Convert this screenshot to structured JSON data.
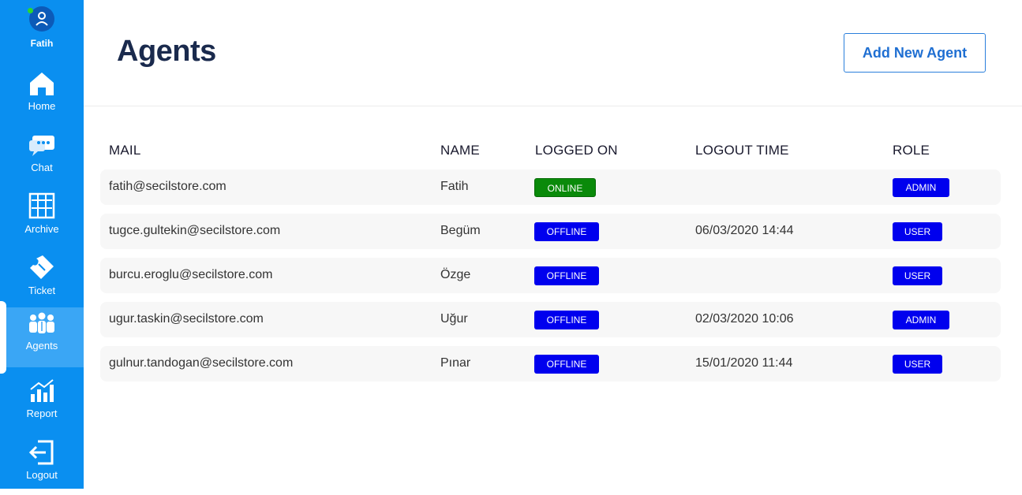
{
  "sidebar": {
    "user": {
      "name": "Fatih"
    },
    "items": [
      {
        "label": "Home",
        "icon": "home-icon"
      },
      {
        "label": "Chat",
        "icon": "chat-icon"
      },
      {
        "label": "Archive",
        "icon": "archive-icon"
      },
      {
        "label": "Ticket",
        "icon": "ticket-icon"
      },
      {
        "label": "Agents",
        "icon": "agents-icon",
        "active": true
      },
      {
        "label": "Report",
        "icon": "report-icon"
      },
      {
        "label": "Logout",
        "icon": "logout-icon"
      }
    ]
  },
  "header": {
    "title": "Agents",
    "add_button_label": "Add New Agent"
  },
  "table": {
    "columns": [
      "MAIL",
      "NAME",
      "LOGGED ON",
      "LOGOUT TIME",
      "ROLE"
    ],
    "rows": [
      {
        "mail": "fatih@secilstore.com",
        "name": "Fatih",
        "status": "ONLINE",
        "logout": "",
        "role": "ADMIN"
      },
      {
        "mail": "tugce.gultekin@secilstore.com",
        "name": "Begüm",
        "status": "OFFLINE",
        "logout": "06/03/2020 14:44",
        "role": "USER"
      },
      {
        "mail": "burcu.eroglu@secilstore.com",
        "name": "Özge",
        "status": "OFFLINE",
        "logout": "",
        "role": "USER"
      },
      {
        "mail": "ugur.taskin@secilstore.com",
        "name": "Uğur",
        "status": "OFFLINE",
        "logout": "02/03/2020 10:06",
        "role": "ADMIN"
      },
      {
        "mail": "gulnur.tandogan@secilstore.com",
        "name": "Pınar",
        "status": "OFFLINE",
        "logout": "15/01/2020 11:44",
        "role": "USER"
      }
    ]
  },
  "colors": {
    "sidebar": "#0a8ff0",
    "online": "#0a8a0a",
    "offline": "#0000ee",
    "role": "#0000ee",
    "accent": "#1f6fd2"
  }
}
